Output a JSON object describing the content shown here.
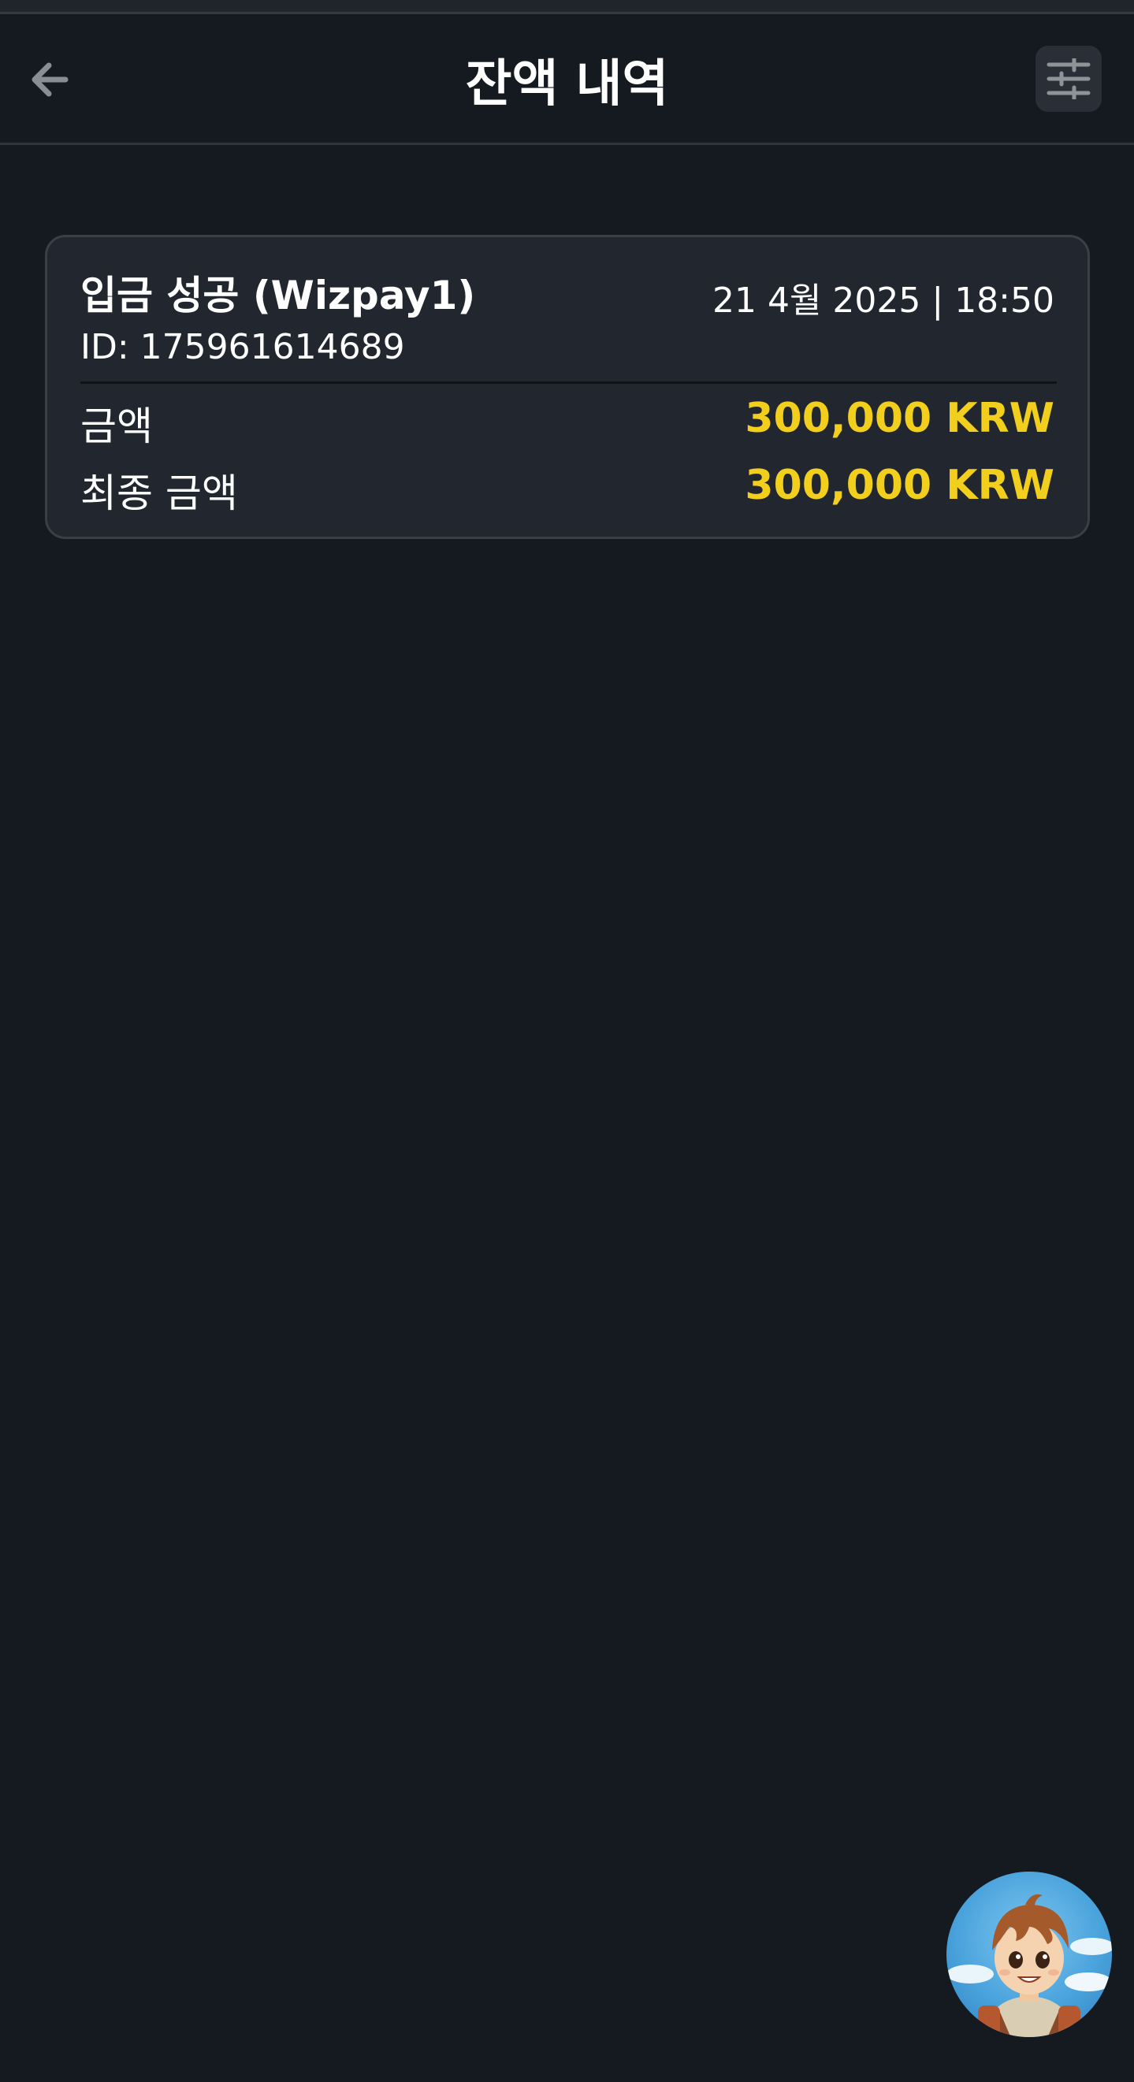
{
  "header": {
    "title": "잔액 내역",
    "back_icon": "arrow-left-icon",
    "filter_icon": "sliders-icon"
  },
  "transactions": [
    {
      "title": "입금 성공 (Wizpay1)",
      "datetime": "21 4월 2025 | 18:50",
      "id_text": "ID: 175961614689",
      "amount_label": "금액",
      "amount_value": "300,000 KRW",
      "final_label": "최종 금액",
      "final_value": "300,000 KRW"
    }
  ],
  "colors": {
    "background": "#151920",
    "card": "#22272f",
    "accent_amount": "#f2cf1d"
  },
  "avatar": {
    "icon": "cartoon-boy-avatar"
  }
}
